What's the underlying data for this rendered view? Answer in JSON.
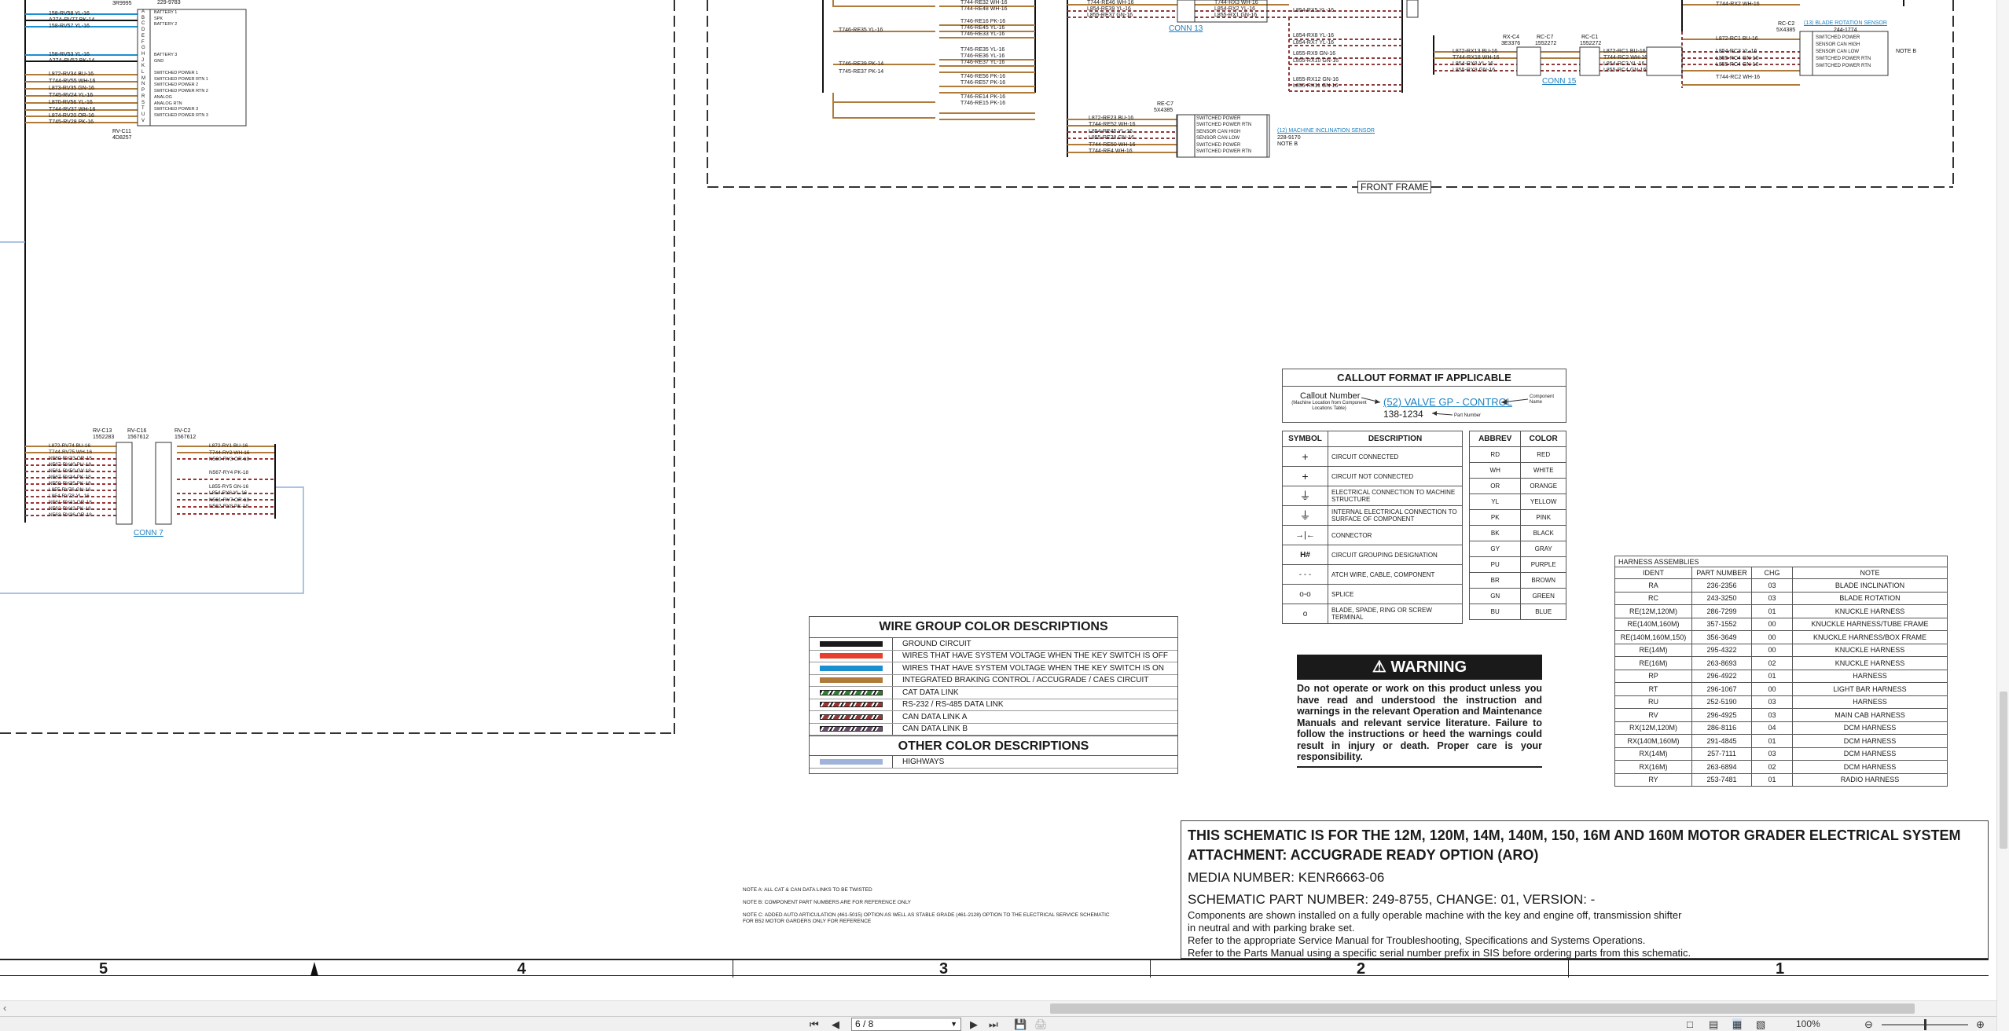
{
  "schematic": {
    "top_left": {
      "part_id": "3R9995",
      "wires_top": [
        "158-RV58 YL-16",
        "A27A-RV77 BK-14",
        "158-RV57 YL-16"
      ],
      "wires_mid": [
        "158-RV53 YL-16",
        "A27A-RV52 BK-14"
      ],
      "wires_bottom": [
        "L872-RV34 BU-16",
        "T744-RV55 WH-16",
        "L873-RV35 GN-16",
        "T745-RV24 YL-16",
        "L870-RV56 YL-16",
        "T744-RV37 WH-16",
        "L874-RV20 OR-16",
        "T745-RV28 PK-16"
      ],
      "connector_pins": "A\nB\nC\nD\nE\nF\nG\nH\nJ\nK\nL\nM\nN\nP\nR\nS\nT\nU\nV",
      "pin_labels": [
        "BATTERY 1",
        "SPK",
        "BATTERY 2",
        "",
        "",
        "",
        "",
        "BATTERY 3",
        "GND",
        "",
        "SWITCHED POWER 1",
        "SWITCHED POWER RTN 1",
        "SWITCHED POWER 2",
        "SWITCHED POWER RTN 2",
        "ANALOG",
        "ANALOG RTN",
        "SWITCHED POWER 3",
        "SWITCHED POWER RTN 3"
      ],
      "connector_name": "RV-C11",
      "connector_part": "4D8257",
      "top_part": "229-9783"
    },
    "bottom_left": {
      "conn_names": [
        "RV-C13",
        "RV-C16",
        "RV-C2"
      ],
      "conn_parts": [
        "1552283",
        "1567612",
        "1567612"
      ],
      "left_wires": [
        "L872-RV74 BU-16",
        "T744-RV75 WH-16",
        "N560-RV33 OR-18",
        "N567-RV40 PU-18",
        "N561-RV50 GY-18",
        "N567-RV34 PK-18",
        "N559-RV35 PK-18",
        "L855-RV76 GN-16",
        "L854-RV78 YL-16",
        "N561-RV41 OR-18",
        "N562-RV42 PK-18",
        "N563-RV36 OR-18"
      ],
      "right_wires": [
        "L872-RY1 BU-16",
        "T744-RY2 WH-16",
        "N560-RY3 OR-18",
        "",
        "N567-RY4 PK-18",
        "",
        "L855-RY5 GN-16",
        "L854-RY6 YL-16",
        "N561-RY7 OR-18",
        "N562-RY8 PK-18"
      ],
      "conn_link": "CONN 7"
    },
    "front_frame": {
      "label": "FRONT FRAME",
      "conn13": "CONN 13",
      "conn15": "CONN 15",
      "col1_wires": [
        "T744-RE32 WH-16",
        "T744-RE48 WH-16",
        "T746-RE16 PK-16",
        "T746-RE45 YL-16",
        "T746-RE33 YL-16",
        "T745-RE35 YL-16",
        "T746-RE36 YL-16",
        "T746-RE37 YL-16",
        "T746-RE38 YL-16",
        "T746-RE56 PK-16",
        "T746-RE57 PK-16",
        "T746-RE14 PK-16",
        "T746-RE15 PK-16"
      ],
      "col0_wires": [
        "T746-RE35 YL-16",
        "T746-RE45 YL-16",
        "T746-RE39 PK-14",
        "T745-RE37 PK-14"
      ],
      "mid_top_wires": [
        "T744-RE46 WH-16",
        "L854-RE39 YL-16",
        "L855-RE37 GN-16",
        "T744-RX3 WH-16",
        "L854-RX2 YL-16",
        "L855-RX1 GN-16"
      ],
      "mid_wires": [
        "L854-RX5 YL-16",
        "L854-RX8 YL-16",
        "L854-RX7 YL-16",
        "L855-RX9 GN-16",
        "L855-RX10 GN-16",
        "L855-RX12 GN-16",
        "L855-RX11 GN-16"
      ],
      "re_c7": {
        "name": "RE-C7",
        "part": "5X4385",
        "wires": [
          "L872-RE23 BU-16",
          "T744-RE52 WH-16",
          "L854-RE45 YL-16",
          "L855-RE28 GN-16",
          "T744-RE50 WH-16",
          "T744-RE4 WH-16"
        ],
        "pins": [
          "SWITCHED POWER",
          "SWITCHED POWER RTN",
          "SENSOR CAN HIGH",
          "SENSOR CAN LOW",
          "SWITCHED POWER",
          "SWITCHED POWER RTN"
        ]
      },
      "machine_inclination": {
        "link": "(12) MACHINE INCLINATION SENSOR",
        "part": "228-9170",
        "note": "NOTE B"
      },
      "rx_c4": {
        "name": "RX-C4",
        "part": "3E3376"
      },
      "rc_c7": {
        "name": "RC-C7",
        "part": "1552272"
      },
      "rc_c1": {
        "name": "RC-C1",
        "part": "1552272"
      },
      "rx_wires": [
        "L872-RX13 BU-16",
        "T744-RX18 WH-16",
        "L854-RX8 YL-16",
        "L855-RX9 GN-16"
      ],
      "rc_wires_left": [
        "L872-RC1 BU-16",
        "T744-RC2 WH-16",
        "L854-RC3 YL-16",
        "L855-RC4 GN-16"
      ],
      "rc_wires_right": [
        "L872-RC1 BU-16",
        "L854-RC3 YL-16",
        "L855-RC4 GN-16",
        "L855-RC4 GN-16",
        "T744-RC2 WH-16"
      ],
      "rc_top_wire": "T744-RX2 WH-16",
      "blade_rotation": {
        "conn": "RC-C2",
        "part": "5X4385",
        "link": "(13) BLADE ROTATION SENSOR",
        "sensor_part": "244-1774",
        "note": "NOTE B",
        "pins": [
          "SWITCHED POWER",
          "SENSOR CAN HIGH",
          "SENSOR CAN LOW",
          "SWITCHED POWER RTN",
          "SWITCHED POWER RTN"
        ]
      }
    }
  },
  "callout": {
    "title": "CALLOUT FORMAT IF APPLICABLE",
    "callout_number": "Callout Number",
    "callout_sub": "(Machine Location from Component Locations Table)",
    "example_link": "(52) VALVE GP - CONTROL",
    "component_name": "Component Name",
    "part_example": "138-1234",
    "part_number_label": "Part Number"
  },
  "symbols": {
    "headers": [
      "SYMBOL",
      "DESCRIPTION"
    ],
    "rows": [
      {
        "icon": "circuit-connected-icon",
        "desc": "CIRCUIT CONNECTED"
      },
      {
        "icon": "circuit-not-connected-icon",
        "desc": "CIRCUIT NOT CONNECTED"
      },
      {
        "icon": "ground-icon",
        "desc": "ELECTRICAL CONNECTION TO MACHINE STRUCTURE"
      },
      {
        "icon": "internal-ground-icon",
        "desc": "INTERNAL ELECTRICAL CONNECTION TO SURFACE OF COMPONENT"
      },
      {
        "icon": "connector-icon",
        "desc": "CONNECTOR"
      },
      {
        "icon": "grouping-icon",
        "desc": "CIRCUIT GROUPING DESIGNATION"
      },
      {
        "icon": "dashed-line-icon",
        "desc": "ATCH WIRE, CABLE, COMPONENT"
      },
      {
        "icon": "splice-icon",
        "desc": "SPLICE"
      },
      {
        "icon": "terminal-icon",
        "desc": "BLADE, SPADE, RING OR SCREW TERMINAL"
      }
    ],
    "glyphs": [
      "+",
      "+",
      "⏚",
      "⏚",
      "→|←",
      "H#",
      "- - -",
      "o-o",
      "o"
    ]
  },
  "colors_table": {
    "headers": [
      "ABBREV",
      "COLOR"
    ],
    "rows": [
      [
        "RD",
        "RED"
      ],
      [
        "WH",
        "WHITE"
      ],
      [
        "OR",
        "ORANGE"
      ],
      [
        "YL",
        "YELLOW"
      ],
      [
        "PK",
        "PINK"
      ],
      [
        "BK",
        "BLACK"
      ],
      [
        "GY",
        "GRAY"
      ],
      [
        "PU",
        "PURPLE"
      ],
      [
        "BR",
        "BROWN"
      ],
      [
        "GN",
        "GREEN"
      ],
      [
        "BU",
        "BLUE"
      ]
    ]
  },
  "wire_groups": {
    "title": "WIRE GROUP COLOR DESCRIPTIONS",
    "rows": [
      {
        "label": "GROUND CIRCUIT",
        "color": "#1a1a1a"
      },
      {
        "label": "WIRES THAT HAVE SYSTEM VOLTAGE WHEN THE KEY SWITCH IS OFF",
        "color": "#e8402e"
      },
      {
        "label": "WIRES THAT HAVE SYSTEM VOLTAGE WHEN THE KEY SWITCH IS ON",
        "color": "#1c8fd0"
      },
      {
        "label": "INTEGRATED BRAKING CONTROL / ACCUGRADE / CAES CIRCUIT",
        "color": "#b07a3a"
      },
      {
        "label": "CAT DATA LINK",
        "color": "#2e7d32"
      },
      {
        "label": "RS-232 / RS-485 DATA LINK",
        "color": "#a03030"
      },
      {
        "label": "CAN DATA LINK A",
        "color": "#8e3b3b"
      },
      {
        "label": "CAN DATA LINK B",
        "color": "#6d4d6d"
      }
    ],
    "other_title": "OTHER COLOR DESCRIPTIONS",
    "other_rows": [
      {
        "label": "HIGHWAYS",
        "color": "#9fb4d8"
      }
    ]
  },
  "warning": {
    "title": "WARNING",
    "text": "Do not operate or work on this product unless you have read and understood the instruction and warnings in the relevant Operation and Maintenance Manuals and relevant service literature. Failure to follow the instructions or heed the warnings could result in injury or death. Proper care is your responsibility."
  },
  "harness": {
    "title": "HARNESS ASSEMBLIES",
    "headers": [
      "IDENT",
      "PART NUMBER",
      "CHG",
      "NOTE"
    ],
    "rows": [
      [
        "RA",
        "236-2356",
        "03",
        "BLADE INCLINATION"
      ],
      [
        "RC",
        "243-3250",
        "03",
        "BLADE ROTATION"
      ],
      [
        "RE(12M,120M)",
        "286-7299",
        "01",
        "KNUCKLE HARNESS"
      ],
      [
        "RE(140M,160M)",
        "357-1552",
        "00",
        "KNUCKLE HARNESS/TUBE FRAME"
      ],
      [
        "RE(140M,160M,150)",
        "356-3649",
        "00",
        "KNUCKLE HARNESS/BOX FRAME"
      ],
      [
        "RE(14M)",
        "295-4322",
        "00",
        "KNUCKLE HARNESS"
      ],
      [
        "RE(16M)",
        "263-8693",
        "02",
        "KNUCKLE HARNESS"
      ],
      [
        "RP",
        "296-4922",
        "01",
        "HARNESS"
      ],
      [
        "RT",
        "296-1067",
        "00",
        "LIGHT BAR HARNESS"
      ],
      [
        "RU",
        "252-5190",
        "03",
        "HARNESS"
      ],
      [
        "RV",
        "296-4925",
        "03",
        "MAIN CAB HARNESS"
      ],
      [
        "RX(12M,120M)",
        "286-8116",
        "04",
        "DCM HARNESS"
      ],
      [
        "RX(140M,160M)",
        "291-4845",
        "01",
        "DCM HARNESS"
      ],
      [
        "RX(14M)",
        "257-7111",
        "03",
        "DCM HARNESS"
      ],
      [
        "RX(16M)",
        "263-6894",
        "02",
        "DCM HARNESS"
      ],
      [
        "RY",
        "253-7481",
        "01",
        "RADIO HARNESS"
      ]
    ]
  },
  "notes": [
    "NOTE A: ALL CAT & CAN DATA LINKS TO BE TWISTED",
    "NOTE B: COMPONENT PART NUMBERS ARE FOR REFERENCE ONLY",
    "NOTE C: ADDED AUTO ARTICULATION (461-5015) OPTION AS WELL AS STABLE GRADE (461-2128) OPTION TO THE ELECTRICAL SERVICE SCHEMATIC",
    "FOR B52 MOTOR GARDERS ONLY FOR REFERENCE"
  ],
  "title_block": {
    "line1": "THIS SCHEMATIC IS FOR THE 12M, 120M, 14M, 140M, 150, 16M AND 160M MOTOR GRADER ELECTRICAL SYSTEM",
    "line2": "ATTACHMENT: ACCUGRADE READY OPTION (ARO)",
    "media": "MEDIA NUMBER: KENR6663-06",
    "part": "SCHEMATIC PART NUMBER: 249-8755, CHANGE: 01, VERSION: -",
    "desc1": "Components are shown installed on a fully operable machine with the key and engine off, transmission shifter",
    "desc2": "in neutral and with parking brake set.",
    "desc3": "Refer to the appropriate Service Manual for Troubleshooting, Specifications and Systems Operations.",
    "desc4": "Refer to the Parts Manual using a specific serial number prefix in SIS before ordering parts from this schematic."
  },
  "zones": [
    "5",
    "4",
    "3",
    "2",
    "1"
  ],
  "viewer": {
    "page_value": "6 / 8",
    "zoom": "100%"
  }
}
